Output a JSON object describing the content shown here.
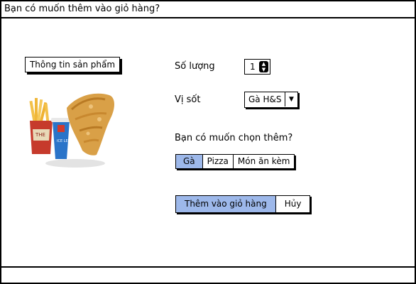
{
  "window": {
    "title": "Bạn có muốn thêm vào giỏ hàng?"
  },
  "product_info_button": "Thông tin sản phẩm",
  "product_image": {
    "icon": "fried-chicken-combo-image",
    "cup_text": "ICE LEMON TEA",
    "box_text": "THE"
  },
  "quantity": {
    "label": "Số lượng",
    "value": "1"
  },
  "sauce": {
    "label": "Vị sốt",
    "selected": "Gà H&S"
  },
  "extras": {
    "question": "Bạn có muốn chọn thêm?",
    "options": [
      "Gà",
      "Pizza",
      "Món ăn kèm"
    ],
    "active_index": 0
  },
  "actions": {
    "add_label": "Thêm vào giỏ hàng",
    "cancel_label": "Hủy"
  },
  "colors": {
    "accent": "#9db8ea",
    "border": "#000000"
  }
}
